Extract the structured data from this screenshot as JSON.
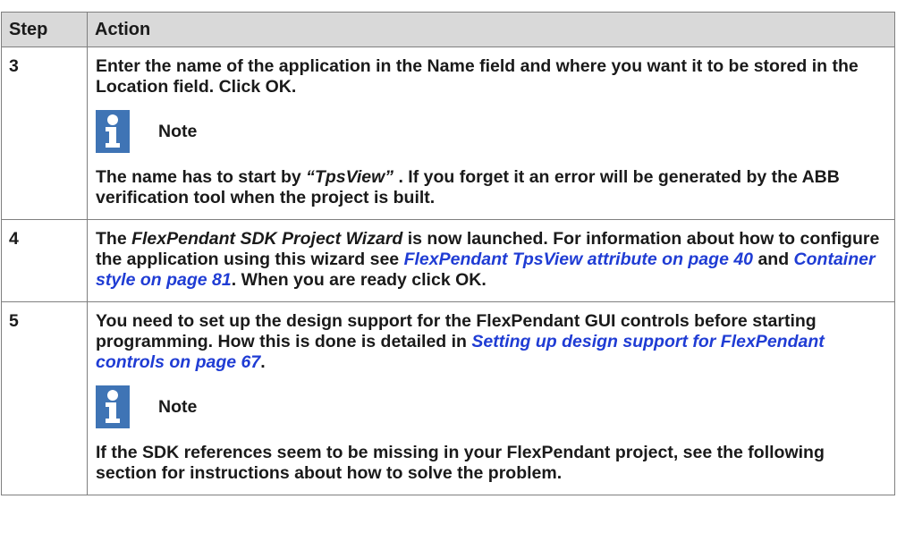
{
  "header": {
    "step": "Step",
    "action": "Action"
  },
  "rows": [
    {
      "step": "3",
      "p1": {
        "a": "Enter the name of the application in the ",
        "b": "Name",
        "c": " field and where you want it to be stored in the ",
        "d": "Location",
        "e": " field. Click ",
        "f": "OK",
        "g": "."
      },
      "note_title": "Note",
      "p2": {
        "a": "The name has to start by ",
        "b": "“TpsView”",
        "c": " . If you forget it an error will be generated by the ABB verification tool when the project is built."
      }
    },
    {
      "step": "4",
      "p1": {
        "a": "The ",
        "b": "FlexPendant SDK Project Wizard",
        "c": " is now launched. For information about how to configure the application using this wizard see ",
        "d": "FlexPendant TpsView attribute on page 40",
        "e": " and ",
        "f": "Container style on page 81",
        "g": ". When you are ready click ",
        "h": "OK",
        "i": "."
      }
    },
    {
      "step": "5",
      "p1": {
        "a": "You need to set up the design support for the FlexPendant GUI controls before starting programming. How this is done is detailed in ",
        "b": "Setting up design support for FlexPendant controls on page 67",
        "c": "."
      },
      "note_title": "Note",
      "p2": "If the SDK references seem to be missing in your FlexPendant project, see the following section for instructions about how to solve the problem."
    }
  ],
  "colors": {
    "header_bg": "#d9d9d9",
    "link": "#1f3cd4",
    "note_icon": "#3f74b5"
  }
}
